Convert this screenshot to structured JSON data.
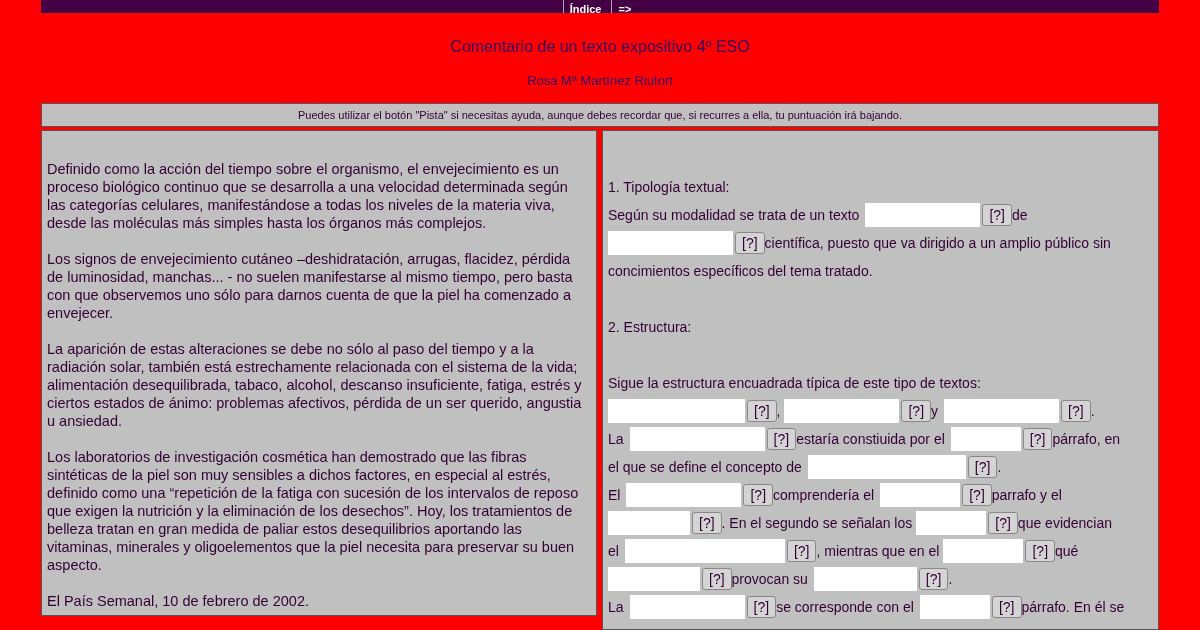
{
  "nav": {
    "buttons": [
      "Índice",
      "=>"
    ]
  },
  "title": "Comentario de un texto expositivo 4º ESO",
  "author": "Rosa Mª Martínez Riutort",
  "notice": "Puedes utilizar el botón \"Pista\" si necesitas ayuda, aunque debes recordar que, si recurres a ella, tu puntuación irá bajando.",
  "reading": {
    "paragraphs": [
      "Definido como la acción del tiempo sobre el organismo, el envejecimiento es un proceso biológico continuo que se desarrolla a una velocidad determinada según las categorías celulares, manifestándose a todas los niveles de la materia viva, desde las moléculas más simples hasta los órganos más complejos.",
      "Los signos de envejecimiento cutáneo –deshidratación, arrugas, flacidez, pérdida de luminosidad, manchas... - no suelen manifestarse al mismo tiempo, pero basta con que observemos uno sólo para darnos cuenta de que la piel ha comenzado a envejecer.",
      "La aparición de estas alteraciones se debe no sólo al paso del tiempo y a la radiación solar, también está estrechamente relacionada con el sistema de la vida; alimentación desequilibrada, tabaco, alcohol, descanso insuficiente, fatiga, estrés y ciertos estados de ánimo: problemas afectivos, pérdida de un ser querido, angustia u ansiedad.",
      "Los laboratorios de investigación cosmética han demostrado que las fibras sintéticas de la piel son muy sensibles a dichos factores, en especial al estrés, definido como una “repetición de la fatiga con sucesión de los intervalos de reposo que exigen la nutrición y la eliminación de los desechos”. Hoy, los tratamientos de belleza tratan en gran medida de paliar estos desequilibrios aportando las vitaminas, minerales y oligoelementos que la piel necesita para preservar su buen aspecto.",
      "El País Semanal, 10 de febrero de 2002."
    ]
  },
  "exercise": {
    "lines": [
      {
        "kind": "gap"
      },
      {
        "kind": "heading",
        "parts": [
          {
            "kind": "text",
            "text": "1. Tipología textual:"
          }
        ]
      },
      {
        "kind": "line",
        "parts": [
          {
            "kind": "text",
            "text": "Según su modalidad se trata de un texto"
          },
          {
            "kind": "blank",
            "hint": "[?]"
          },
          {
            "kind": "text",
            "text": "de"
          }
        ]
      },
      {
        "kind": "line",
        "parts": [
          {
            "kind": "blank",
            "hint": "[?]"
          },
          {
            "kind": "text",
            "text": "científica, puesto que va dirigido a un amplio público sin"
          }
        ]
      },
      {
        "kind": "line",
        "parts": [
          {
            "kind": "text",
            "text": "concimientos específicos del tema tratado."
          }
        ]
      },
      {
        "kind": "gap"
      },
      {
        "kind": "heading",
        "parts": [
          {
            "kind": "text",
            "text": "2. Estructura:"
          }
        ]
      },
      {
        "kind": "gap"
      },
      {
        "kind": "line",
        "parts": [
          {
            "kind": "text",
            "text": "Sigue la estructura encuadrada típica de este tipo de textos:"
          }
        ]
      },
      {
        "kind": "line",
        "parts": [
          {
            "kind": "blank",
            "hint": "[?]"
          },
          {
            "kind": "text",
            "text": ","
          },
          {
            "kind": "blank",
            "hint": "[?]"
          },
          {
            "kind": "text",
            "text": "y"
          },
          {
            "kind": "blank",
            "hint": "[?]"
          },
          {
            "kind": "text",
            "text": "."
          }
        ]
      },
      {
        "kind": "line",
        "parts": [
          {
            "kind": "text",
            "text": "La"
          },
          {
            "kind": "blank",
            "hint": "[?]"
          },
          {
            "kind": "text",
            "text": "estaría constiuida por el"
          },
          {
            "kind": "blank",
            "hint": "[?]"
          },
          {
            "kind": "text",
            "text": "párrafo, en"
          }
        ]
      },
      {
        "kind": "line",
        "parts": [
          {
            "kind": "text",
            "text": "el que se define el concepto de"
          },
          {
            "kind": "blank",
            "hint": "[?]"
          },
          {
            "kind": "text",
            "text": "."
          }
        ]
      },
      {
        "kind": "line",
        "parts": [
          {
            "kind": "text",
            "text": "El"
          },
          {
            "kind": "blank",
            "hint": "[?]"
          },
          {
            "kind": "text",
            "text": "comprendería el"
          },
          {
            "kind": "blank",
            "hint": "[?]"
          },
          {
            "kind": "text",
            "text": "parrafo y el"
          }
        ]
      },
      {
        "kind": "line",
        "parts": [
          {
            "kind": "blank",
            "hint": "[?]"
          },
          {
            "kind": "text",
            "text": ". En el segundo se señalan los"
          },
          {
            "kind": "blank",
            "hint": "[?]"
          },
          {
            "kind": "text",
            "text": "que evidencian"
          }
        ]
      },
      {
        "kind": "line",
        "parts": [
          {
            "kind": "text",
            "text": "el"
          },
          {
            "kind": "blank",
            "hint": "[?]"
          },
          {
            "kind": "text",
            "text": ", mientras que en el"
          },
          {
            "kind": "blank",
            "hint": "[?]"
          },
          {
            "kind": "text",
            "text": "qué"
          }
        ]
      },
      {
        "kind": "line",
        "parts": [
          {
            "kind": "blank",
            "hint": "[?]"
          },
          {
            "kind": "text",
            "text": "provocan su"
          },
          {
            "kind": "blank",
            "hint": "[?]"
          },
          {
            "kind": "text",
            "text": "."
          }
        ]
      },
      {
        "kind": "line",
        "parts": [
          {
            "kind": "text",
            "text": "La"
          },
          {
            "kind": "blank",
            "hint": "[?]"
          },
          {
            "kind": "text",
            "text": "se corresponde con el"
          },
          {
            "kind": "blank",
            "hint": "[?]"
          },
          {
            "kind": "text",
            "text": "párrafo. En él se"
          }
        ]
      }
    ]
  }
}
